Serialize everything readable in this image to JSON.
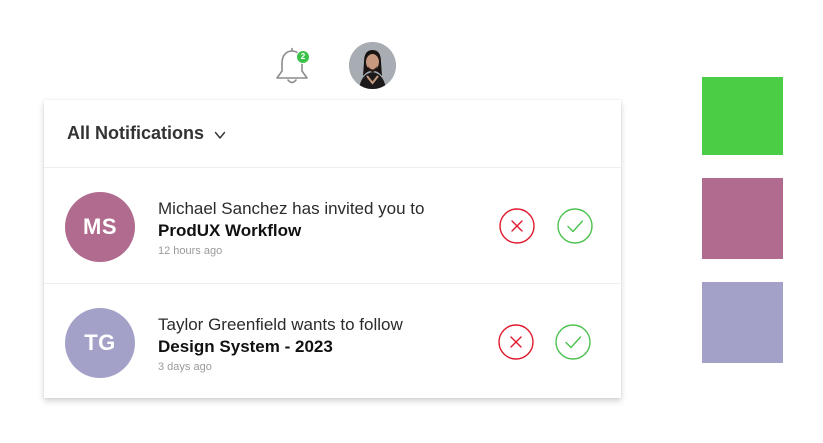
{
  "topbar": {
    "bell_icon": "bell-icon",
    "badge_count": "2",
    "badge_color": "#3cc24a",
    "avatar_icon": "user-avatar"
  },
  "panel": {
    "title": "All Notifications",
    "title_icon": "chevron-down-icon",
    "notifications": [
      {
        "initials": "MS",
        "avatar_color": "#b16b8e",
        "message": "Michael Sanchez has invited you to",
        "subject": "ProdUX Workflow",
        "time": "12 hours ago",
        "reject_icon": "close-circle-icon",
        "accept_icon": "check-circle-icon"
      },
      {
        "initials": "TG",
        "avatar_color": "#a3a1c8",
        "message": "Taylor Greenfield wants to follow",
        "subject": "Design System - 2023",
        "time": "3 days ago",
        "reject_icon": "close-circle-icon",
        "accept_icon": "check-circle-icon"
      }
    ]
  },
  "colors": {
    "reject": "#e0182d",
    "accept": "#4cc24e"
  },
  "swatches": [
    {
      "name": "green",
      "color": "#4ccd46"
    },
    {
      "name": "mauve",
      "color": "#b16b8e"
    },
    {
      "name": "lavender",
      "color": "#a3a1c8"
    }
  ]
}
